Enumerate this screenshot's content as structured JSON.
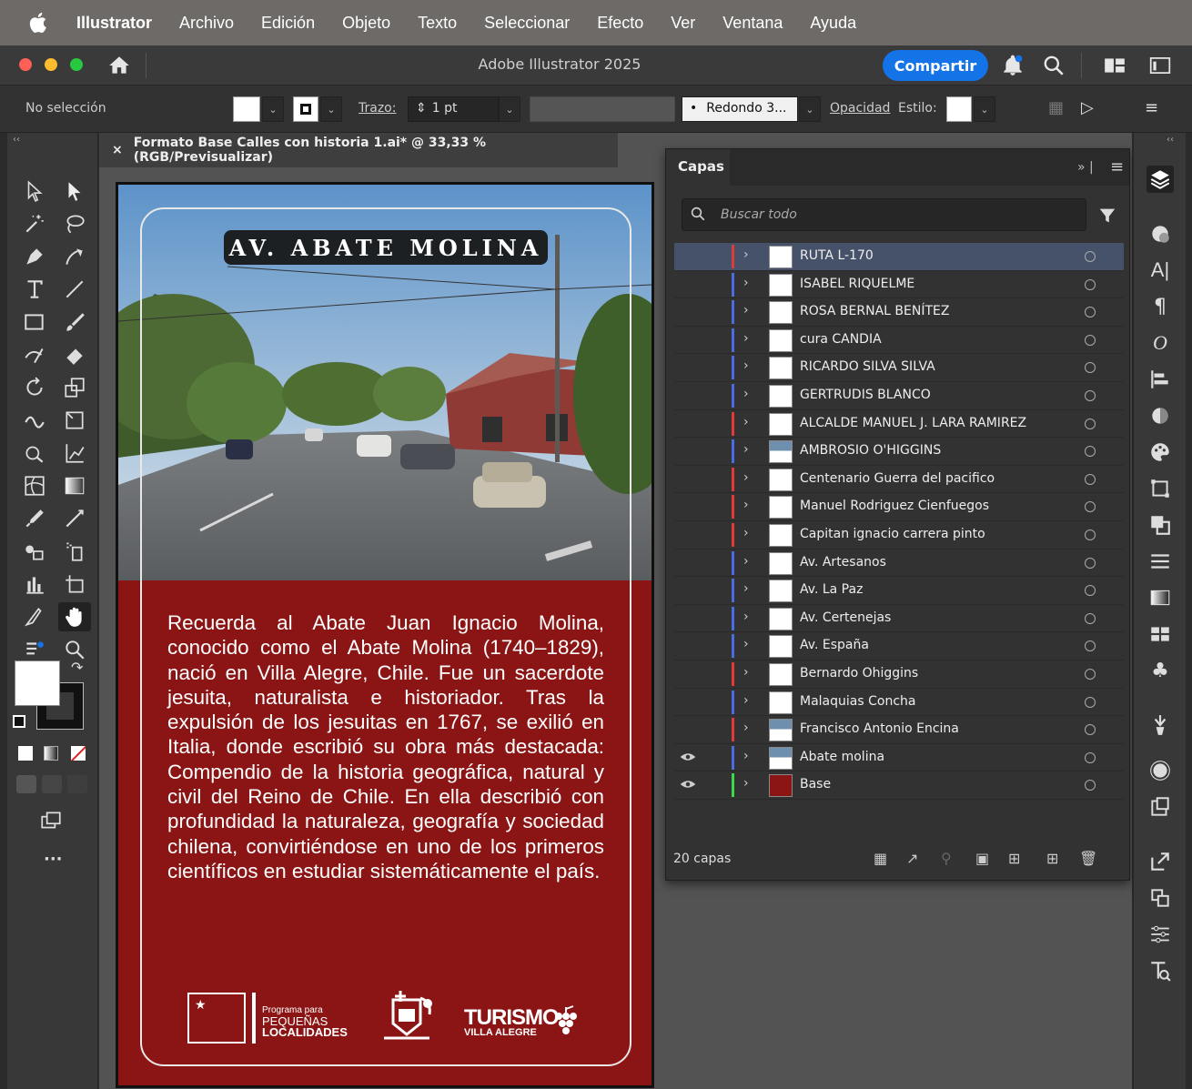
{
  "menubar": {
    "app": "Illustrator",
    "items": [
      "Archivo",
      "Edición",
      "Objeto",
      "Texto",
      "Seleccionar",
      "Efecto",
      "Ver",
      "Ventana",
      "Ayuda"
    ]
  },
  "titlebar": {
    "title": "Adobe Illustrator 2025",
    "share_label": "Compartir"
  },
  "controlbar": {
    "selection": "No selección",
    "stroke_label": "Trazo:",
    "stroke_value": "1 pt",
    "brush_value": "Redondo 3...",
    "opacity_label": "Opacidad",
    "style_label": "Estilo:"
  },
  "document": {
    "tab_title": "Formato Base Calles con historia 1.ai* @ 33,33 % (RGB/Previsualizar)",
    "street_name": "AV. ABATE MOLINA",
    "body": "Recuerda al Abate Juan Ignacio Molina, conocido como el Abate Molina (1740–1829), nació en Villa Alegre, Chile. Fue un sacerdote jesuita, naturalista e historiador. Tras la expulsión de los jesuitas en 1767, se exilió en Italia, donde escribió su obra más destacada: Compendio de la historia geográfica, natural y civil del Reino de Chile. En ella describió con profundidad la naturaleza, geografía y sociedad chilena, convirtiéndose en uno de los primeros científicos en estudiar sistemáticamente el país.",
    "logo_program_line1": "Programa para",
    "logo_program_line2": "PEQUEÑAS",
    "logo_program_line3": "LOCALIDADES",
    "logo_turismo": "TURISMO",
    "logo_villa": "VILLA ALEGRE"
  },
  "layers_panel": {
    "tab": "Capas",
    "search_placeholder": "Buscar todo",
    "count": "20 capas",
    "layers": [
      {
        "name": "RUTA L-170",
        "color": "#e03a3a",
        "selected": true,
        "visible": false
      },
      {
        "name": "ISABEL RIQUELME",
        "color": "#4a6ee0",
        "selected": false,
        "visible": false
      },
      {
        "name": "ROSA BERNAL BENÍTEZ",
        "color": "#4a6ee0",
        "selected": false,
        "visible": false
      },
      {
        "name": "cura CANDIA",
        "color": "#4a6ee0",
        "selected": false,
        "visible": false
      },
      {
        "name": "RICARDO SILVA SILVA",
        "color": "#4a6ee0",
        "selected": false,
        "visible": false
      },
      {
        "name": "GERTRUDIS BLANCO",
        "color": "#4a6ee0",
        "selected": false,
        "visible": false
      },
      {
        "name": "ALCALDE MANUEL J. LARA RAMIREZ",
        "color": "#e03a3a",
        "selected": false,
        "visible": false
      },
      {
        "name": "AMBROSIO O'HIGGINS",
        "color": "#4a6ee0",
        "selected": false,
        "visible": false
      },
      {
        "name": "Centenario Guerra del pacifico",
        "color": "#e03a3a",
        "selected": false,
        "visible": false
      },
      {
        "name": "Manuel Rodriguez Cienfuegos",
        "color": "#e03a3a",
        "selected": false,
        "visible": false
      },
      {
        "name": "Capitan ignacio carrera pinto",
        "color": "#e03a3a",
        "selected": false,
        "visible": false
      },
      {
        "name": "Av. Artesanos",
        "color": "#4a6ee0",
        "selected": false,
        "visible": false
      },
      {
        "name": "Av. La Paz",
        "color": "#4a6ee0",
        "selected": false,
        "visible": false
      },
      {
        "name": "Av. Certenejas",
        "color": "#4a6ee0",
        "selected": false,
        "visible": false
      },
      {
        "name": "Av. España",
        "color": "#4a6ee0",
        "selected": false,
        "visible": false
      },
      {
        "name": "Bernardo Ohiggins",
        "color": "#e03a3a",
        "selected": false,
        "visible": false
      },
      {
        "name": "Malaquias Concha",
        "color": "#4a6ee0",
        "selected": false,
        "visible": false
      },
      {
        "name": "Francisco Antonio Encina",
        "color": "#e03a3a",
        "selected": false,
        "visible": false
      },
      {
        "name": "Abate molina",
        "color": "#4a6ee0",
        "selected": false,
        "visible": true
      },
      {
        "name": "Base",
        "color": "#3ed94a",
        "selected": false,
        "visible": true
      }
    ]
  },
  "colors": {
    "accent": "#1473e6",
    "artboard_red": "#8b1515"
  }
}
